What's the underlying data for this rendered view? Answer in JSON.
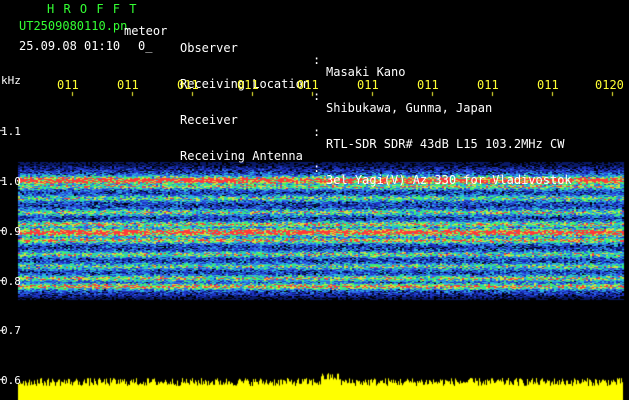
{
  "header": {
    "brand": "H R O F F T",
    "filename": "UT2509080110.pn",
    "kind": "meteor",
    "datetime": "25.09.08 01:10",
    "count": "0_"
  },
  "info": [
    {
      "label": "Observer",
      "value": "Masaki Kano"
    },
    {
      "label": "Receiving Location",
      "value": "Shibukawa, Gunma, Japan"
    },
    {
      "label": "Receiver",
      "value": "RTL-SDR SDR# 43dB L15 103.2MHz CW"
    },
    {
      "label": "Receiving Antenna",
      "value": "3el Yagi(V) Az 330 for Vladivostok"
    }
  ],
  "time_ticks": [
    "011",
    "011",
    "011",
    "011",
    "011",
    "011",
    "011",
    "011",
    "011",
    "0120"
  ],
  "freq_axis": {
    "unit": "kHz",
    "labels": [
      "1.1",
      "1.0",
      "0.9",
      "0.8",
      "0.7",
      "0.6"
    ]
  },
  "colors": {
    "background": "#000000",
    "brand": "#33ff33",
    "text": "#ffffff",
    "ticks": "#ffff33",
    "noise_bar": "#ffff00"
  }
}
